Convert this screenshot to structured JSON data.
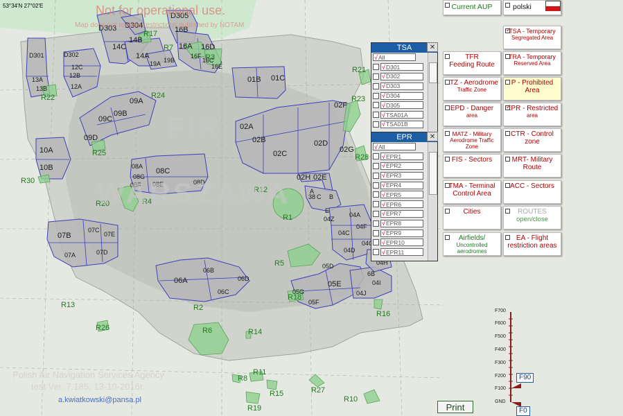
{
  "map": {
    "coordinates": "53°34'N  27°02'E",
    "warning": "Not for operational use.",
    "warning_sub": "Map does not replace restrictions published by NOTAM",
    "fir_left": "FIR",
    "fir_bottom": "WARSZAWA",
    "agency": "Polish Air Navigation Services Agency",
    "version": "test Ver.  7.185,   13-10-2016r.",
    "email": "a.kwiatkowski@pansa.pl",
    "zones": [
      {
        "label": "D301"
      },
      {
        "label": "D302"
      },
      {
        "label": "D303"
      },
      {
        "label": "D304"
      },
      {
        "label": "D305"
      },
      {
        "label": "12C"
      },
      {
        "label": "12B"
      },
      {
        "label": "12A"
      },
      {
        "label": "13A"
      },
      {
        "label": "13B"
      },
      {
        "label": "14C"
      },
      {
        "label": "14B"
      },
      {
        "label": "14A"
      },
      {
        "label": "16B"
      },
      {
        "label": "16A"
      },
      {
        "label": "16D"
      },
      {
        "label": "16F"
      },
      {
        "label": "16C"
      },
      {
        "label": "16E"
      },
      {
        "label": "19A"
      },
      {
        "label": "19B"
      },
      {
        "label": "01B"
      },
      {
        "label": "01C"
      },
      {
        "label": "09A"
      },
      {
        "label": "09B"
      },
      {
        "label": "09C"
      },
      {
        "label": "09D"
      },
      {
        "label": "10A"
      },
      {
        "label": "10B"
      },
      {
        "label": "08A"
      },
      {
        "label": "08C"
      },
      {
        "label": "08G"
      },
      {
        "label": "08F"
      },
      {
        "label": "08E"
      },
      {
        "label": "08D"
      },
      {
        "label": "02A"
      },
      {
        "label": "02B"
      },
      {
        "label": "02C"
      },
      {
        "label": "02D"
      },
      {
        "label": "02F"
      },
      {
        "label": "02G"
      },
      {
        "label": "02H"
      },
      {
        "label": "02E"
      },
      {
        "label": "A"
      },
      {
        "label": "38"
      },
      {
        "label": "C"
      },
      {
        "label": "B"
      },
      {
        "label": "E"
      },
      {
        "label": "04Z"
      },
      {
        "label": "04A"
      },
      {
        "label": "04F"
      },
      {
        "label": "04C"
      },
      {
        "label": "04D"
      },
      {
        "label": "04H"
      },
      {
        "label": "07B"
      },
      {
        "label": "07C"
      },
      {
        "label": "07E"
      },
      {
        "label": "07A"
      },
      {
        "label": "07D"
      },
      {
        "label": "06B"
      },
      {
        "label": "06A"
      },
      {
        "label": "06D"
      },
      {
        "label": "06C"
      },
      {
        "label": "05D"
      },
      {
        "label": "05G"
      },
      {
        "label": "05E"
      },
      {
        "label": "05F"
      },
      {
        "label": "04J"
      },
      {
        "label": "04I"
      },
      {
        "label": "6B"
      }
    ],
    "restricted": [
      "R1",
      "R2",
      "R3",
      "R4",
      "R5",
      "R6",
      "R7",
      "R8",
      "R10",
      "R11",
      "R12",
      "R13",
      "R14",
      "R15",
      "R16",
      "R17",
      "R18",
      "R19",
      "R20",
      "R21",
      "R22",
      "R23",
      "R24",
      "R25",
      "R26",
      "R27",
      "R28",
      "R30"
    ]
  },
  "tsa_popup": {
    "title": "TSA",
    "close": "✕",
    "all_label": "All",
    "items": [
      "D301",
      "D302",
      "D303",
      "D304",
      "D305",
      "TSA01A",
      "TSA01B"
    ]
  },
  "epr_popup": {
    "title": "EPR",
    "close": "✕",
    "all_label": "All",
    "items": [
      "EPR1",
      "EPR2",
      "EPR3",
      "EPR4",
      "EPR5",
      "EPR6",
      "EPR7",
      "EPR8",
      "EPR9",
      "EPR10",
      "EPR11"
    ]
  },
  "panel": {
    "current_aup": "Current AUP",
    "polski": "polski",
    "buttons": [
      {
        "id": "tsa",
        "line1": "TSA - Temporary",
        "line2": "Segregated Area",
        "checked": true
      },
      {
        "id": "tfr",
        "line1": "TFR",
        "line2": "Feeding Route",
        "checked": false
      },
      {
        "id": "tra",
        "line1": "TRA - Temporary",
        "line2": "Reserved Area",
        "checked": false
      },
      {
        "id": "atz",
        "line1": "ATZ - Aerodrome",
        "line2": "Traffic Zone",
        "checked": false
      },
      {
        "id": "p",
        "line1": "P  - Prohibited",
        "line2": "Area",
        "checked": false
      },
      {
        "id": "epd",
        "line1": "EPD - Danger",
        "line2": "area",
        "checked": false
      },
      {
        "id": "epr",
        "line1": "EPR - Restricted",
        "line2": "area",
        "checked": true
      },
      {
        "id": "matz",
        "line1": "MATZ - Military",
        "line2": "Aerodrome Traffic Zone",
        "checked": false
      },
      {
        "id": "ctr",
        "line1": "CTR - Control",
        "line2": "zone",
        "checked": false
      },
      {
        "id": "fis",
        "line1": "FIS - Sectors",
        "line2": "",
        "checked": false
      },
      {
        "id": "mrt",
        "line1": "MRT- Military",
        "line2": "Route",
        "checked": false
      },
      {
        "id": "tma",
        "line1": "TMA - Terminal",
        "line2": "Control Area",
        "checked": false
      },
      {
        "id": "acc",
        "line1": "ACC - Sectors",
        "line2": "",
        "checked": false
      },
      {
        "id": "cities",
        "line1": "Cities",
        "line2": "",
        "checked": false
      },
      {
        "id": "routes",
        "line1": "ROUTES",
        "line2": "open/close",
        "checked": false
      },
      {
        "id": "airfields",
        "line1": "Airfields/",
        "line2": "Uncontrolled aerodromes",
        "checked": false
      },
      {
        "id": "ea",
        "line1": "EA - Flight",
        "line2": "restriction areas",
        "checked": false
      }
    ],
    "print": "Print"
  },
  "altitude": {
    "labels": [
      "F700",
      "F600",
      "F500",
      "F400",
      "F300",
      "F200",
      "F100",
      "GND"
    ],
    "upper": "F90",
    "lower": "F0"
  },
  "colors": {
    "zone_fill": "#b6b6b6",
    "zone_line": "#3d3dbf",
    "r_fill": "#8fd08f",
    "r_text": "#1f7a1f",
    "land": "#cfd3cb",
    "sea": "#cfe9d1",
    "accent": "#1b5ea6"
  }
}
